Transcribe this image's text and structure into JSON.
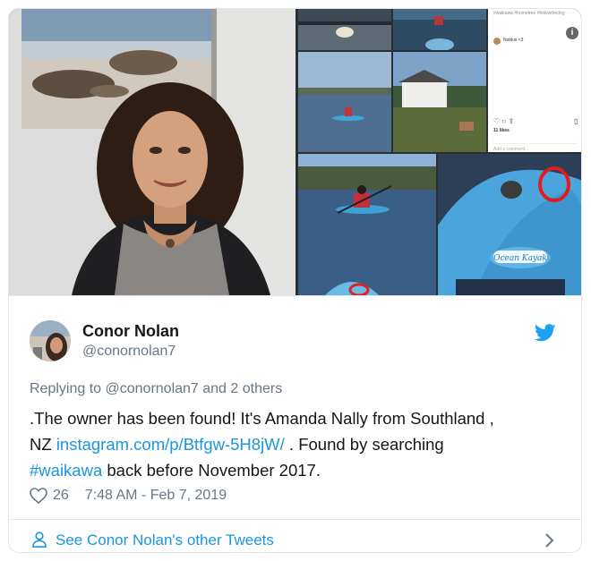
{
  "tweet": {
    "author_name": "Conor Nolan",
    "author_handle": "@conornolan7",
    "replying_prefix": "Replying to ",
    "replying_handle": "@conornolan7",
    "replying_suffix": " and 2 others",
    "text_line1": ".The owner has been found! It's Amanda Nally from Southland ,",
    "text_pre_link": "NZ ",
    "link_url": "instagram.com/p/Btfgw-5H8jW/",
    "text_post_link": " . Found by searching",
    "hashtag": "#waikawa",
    "text_end": " back before November 2017.",
    "likes": "26",
    "timestamp": "7:48 AM - Feb 7, 2019",
    "see_more": "See Conor Nolan's other Tweets"
  },
  "instagram_panel": {
    "caption": "#waikawa #hometree #followthedog",
    "comment_user": "Nobkis <3",
    "likes": "11 likes",
    "add_comment": "Add a comment..."
  },
  "kayak_label": "Ocean Kayak",
  "colors": {
    "link": "#1b95e0",
    "muted": "#657786",
    "text": "#14171a",
    "border": "#e1e8ed",
    "twitter_blue": "#1da1f2"
  },
  "icons": {
    "twitter": "twitter-bird-icon",
    "like": "heart-icon",
    "profile": "person-icon",
    "next": "chevron-right-icon"
  }
}
